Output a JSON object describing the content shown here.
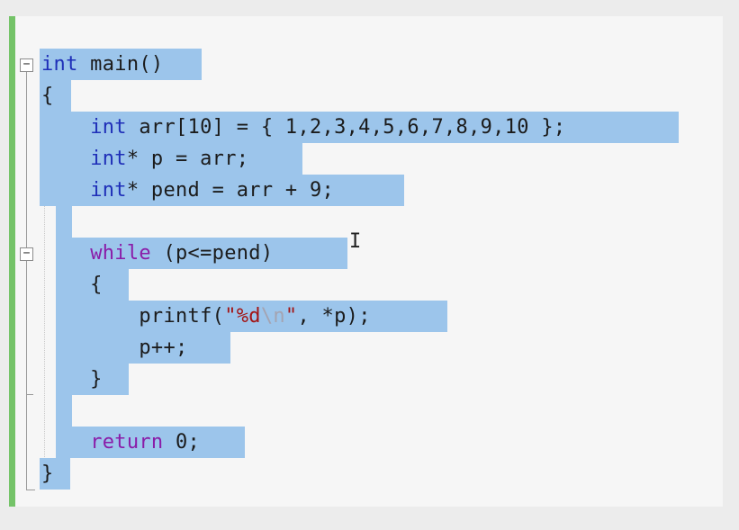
{
  "editor": {
    "language": "C",
    "lines": [
      {
        "tokens": [
          {
            "t": "int",
            "c": "kw"
          },
          {
            "t": " main()",
            "c": ""
          }
        ]
      },
      {
        "tokens": [
          {
            "t": "{",
            "c": ""
          }
        ]
      },
      {
        "tokens": [
          {
            "t": "    ",
            "c": ""
          },
          {
            "t": "int",
            "c": "kw"
          },
          {
            "t": " arr[10] = { 1,2,3,4,5,6,7,8,9,10 };",
            "c": ""
          }
        ]
      },
      {
        "tokens": [
          {
            "t": "    ",
            "c": ""
          },
          {
            "t": "int",
            "c": "kw"
          },
          {
            "t": "* p = arr;",
            "c": ""
          }
        ]
      },
      {
        "tokens": [
          {
            "t": "    ",
            "c": ""
          },
          {
            "t": "int",
            "c": "kw"
          },
          {
            "t": "* pend = arr + 9;",
            "c": ""
          }
        ]
      },
      {
        "tokens": []
      },
      {
        "tokens": [
          {
            "t": "    ",
            "c": ""
          },
          {
            "t": "while",
            "c": "kw-flow"
          },
          {
            "t": " (p<=pend)",
            "c": ""
          }
        ]
      },
      {
        "tokens": [
          {
            "t": "    {",
            "c": ""
          }
        ]
      },
      {
        "tokens": [
          {
            "t": "        printf(",
            "c": ""
          },
          {
            "t": "\"%d",
            "c": "str"
          },
          {
            "t": "\\n",
            "c": "esc"
          },
          {
            "t": "\"",
            "c": "str"
          },
          {
            "t": ", *p);",
            "c": ""
          }
        ]
      },
      {
        "tokens": [
          {
            "t": "        p++;",
            "c": ""
          }
        ]
      },
      {
        "tokens": [
          {
            "t": "    }",
            "c": ""
          }
        ]
      },
      {
        "tokens": []
      },
      {
        "tokens": [
          {
            "t": "    ",
            "c": ""
          },
          {
            "t": "return",
            "c": "kw-flow"
          },
          {
            "t": " 0;",
            "c": ""
          }
        ]
      },
      {
        "tokens": [
          {
            "t": "}",
            "c": ""
          }
        ]
      }
    ],
    "fold_markers": [
      {
        "line": 0,
        "glyph": "−",
        "state": "expanded"
      },
      {
        "line": 6,
        "glyph": "−",
        "state": "expanded"
      }
    ],
    "selection": "all lines selected",
    "colors": {
      "background": "#f6f6f6",
      "selection": "#9cc5eb",
      "change_bar": "#74c368",
      "keyword": "#1f2fb8",
      "flow_keyword": "#8a1ca8",
      "string": "#a31515",
      "escape": "#a4a4b2"
    }
  },
  "mouse": {
    "cursor_icon": "text-ibeam-cursor",
    "glyph": "I"
  }
}
